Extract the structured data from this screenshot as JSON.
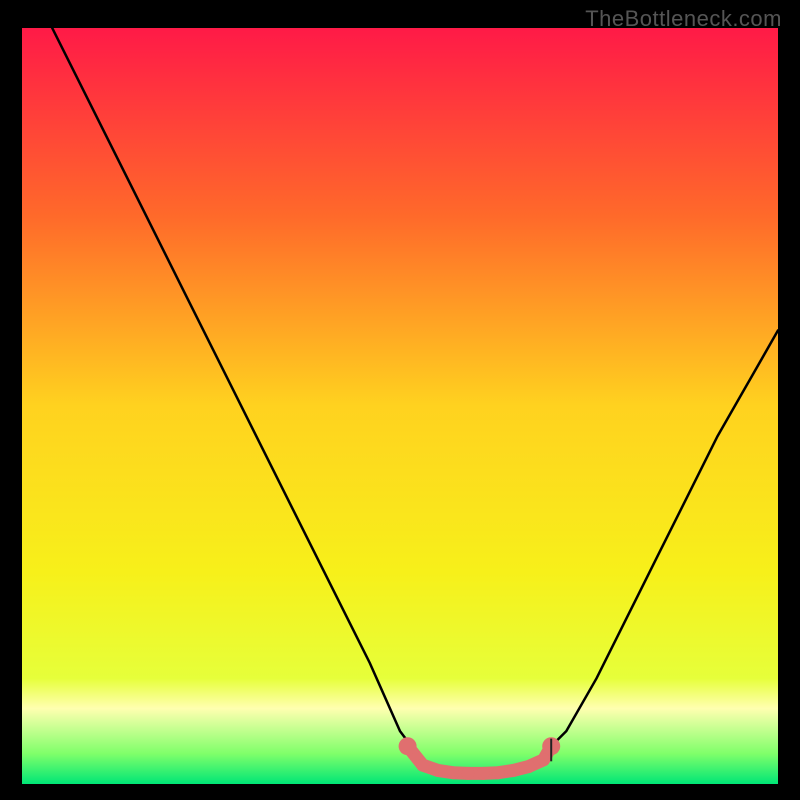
{
  "watermark": "TheBottleneck.com",
  "chart_data": {
    "type": "line",
    "title": "",
    "xlabel": "",
    "ylabel": "",
    "xlim": [
      0,
      100
    ],
    "ylim": [
      0,
      100
    ],
    "background_gradient": {
      "stops": [
        {
          "offset": 0.0,
          "color": "#ff1a47"
        },
        {
          "offset": 0.25,
          "color": "#ff6a2a"
        },
        {
          "offset": 0.5,
          "color": "#ffd21f"
        },
        {
          "offset": 0.72,
          "color": "#f7f01a"
        },
        {
          "offset": 0.86,
          "color": "#e6ff3a"
        },
        {
          "offset": 0.9,
          "color": "#ffffb0"
        },
        {
          "offset": 0.96,
          "color": "#7fff6a"
        },
        {
          "offset": 1.0,
          "color": "#00e676"
        }
      ]
    },
    "series": [
      {
        "name": "bottleneck-curve-left",
        "x": [
          4,
          10,
          16,
          22,
          28,
          34,
          40,
          46,
          50,
          53
        ],
        "y": [
          100,
          88,
          76,
          64,
          52,
          40,
          28,
          16,
          7,
          3
        ],
        "stroke": "#000000",
        "stroke_width": 2.5
      },
      {
        "name": "bottleneck-curve-right",
        "x": [
          68,
          72,
          76,
          80,
          84,
          88,
          92,
          96,
          100
        ],
        "y": [
          3,
          7,
          14,
          22,
          30,
          38,
          46,
          53,
          60
        ],
        "stroke": "#000000",
        "stroke_width": 2.5
      }
    ],
    "highlight_band": {
      "name": "optimal-range",
      "color": "#e06f6f",
      "x": [
        51,
        53,
        55,
        57,
        59,
        61,
        63,
        65,
        67,
        69,
        70
      ],
      "y": [
        5,
        2.5,
        1.8,
        1.5,
        1.4,
        1.4,
        1.5,
        1.8,
        2.3,
        3.2,
        5
      ]
    }
  }
}
